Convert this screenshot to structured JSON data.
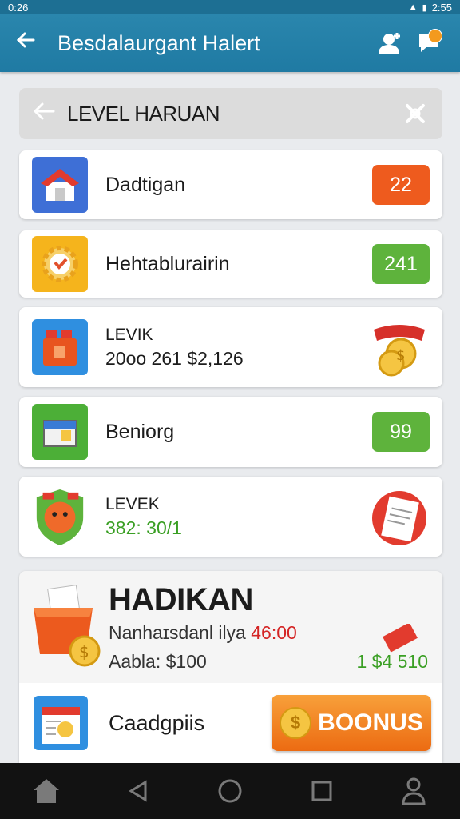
{
  "status_bar": {
    "time": "0:26",
    "battery_time": "2:55"
  },
  "app_bar": {
    "title": "Besdalaurgant Halert"
  },
  "section_header": {
    "title": "LEVEL HARUAN"
  },
  "items": [
    {
      "name": "Dadtigan",
      "badge": "22",
      "badge_color": "#ee5b1e"
    },
    {
      "name": "Hehtablurairin",
      "badge": "241",
      "badge_color": "#5eb33c"
    },
    {
      "line1": "LEVIK",
      "line2": "20oo 261 $2,126"
    },
    {
      "name": "Beniorg",
      "badge": "99",
      "badge_color": "#5eb33c"
    },
    {
      "line1": "LEVEK",
      "line2": "382: 30/1"
    }
  ],
  "panel": {
    "title": "HADIKAN",
    "description": "Nanhaɪsdanl ilya",
    "description_value": "46:00",
    "amount": "Aabla: $100",
    "right_amount": "1 $4   510",
    "bottom_label": "Caadgpiis",
    "bonus_label": "BOONUS",
    "coin_symbol": "$"
  }
}
